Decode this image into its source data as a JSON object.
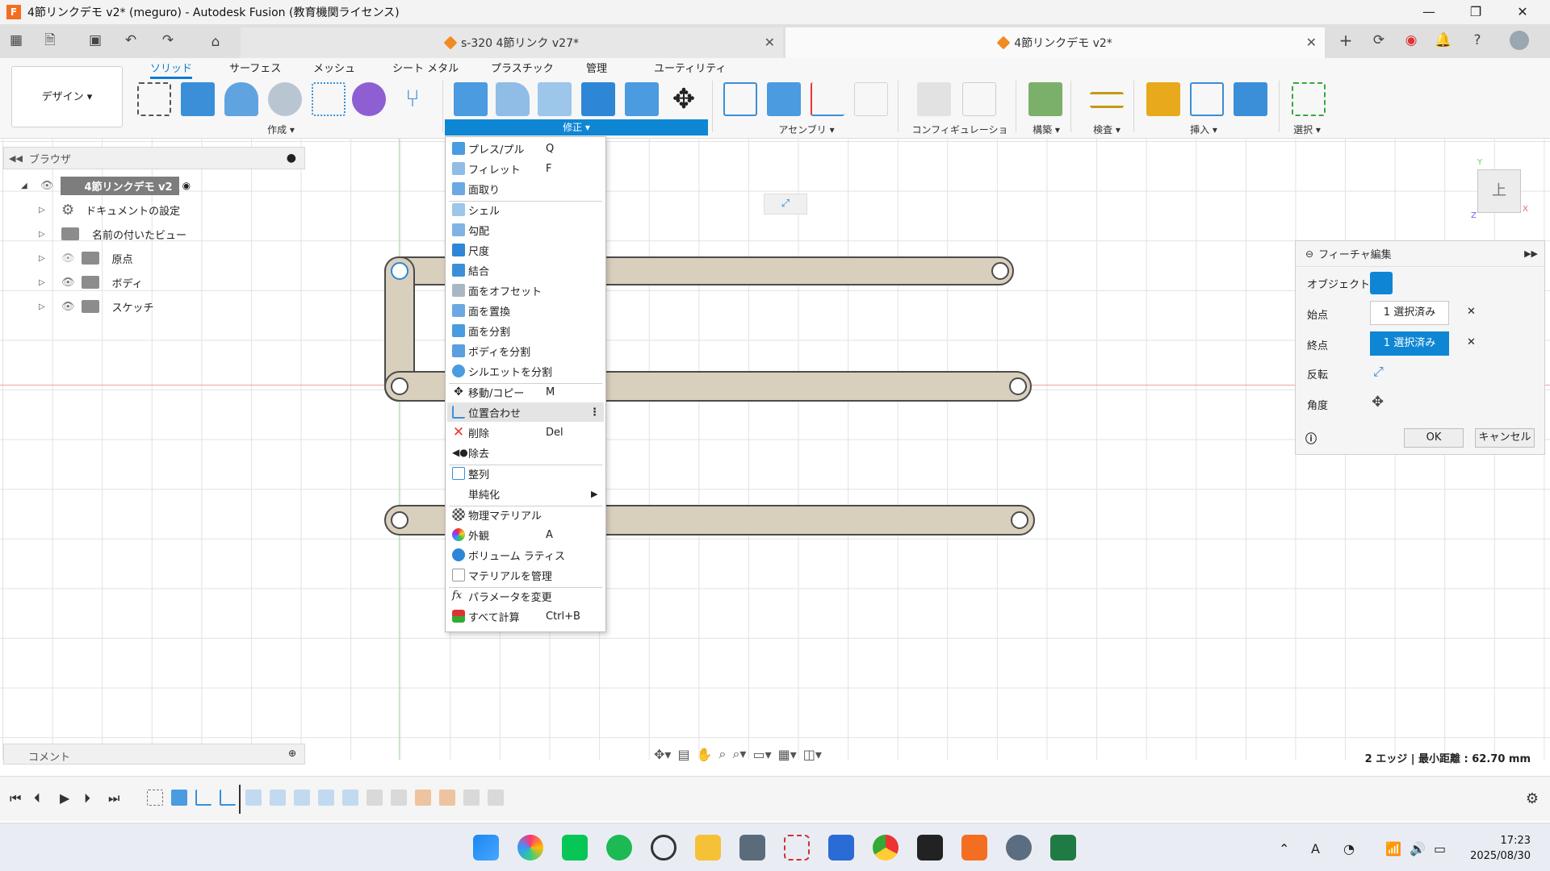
{
  "window": {
    "title": "4節リンクデモ v2* (meguro) - Autodesk Fusion (教育機関ライセンス)",
    "app_icon": "F"
  },
  "tabs": {
    "inactive": "s-320 4節リンク v27*",
    "active": "4節リンクデモ v2*"
  },
  "ribbon": {
    "workspace": "デザイン ▾",
    "tabs": [
      "ソリッド",
      "サーフェス",
      "メッシュ",
      "シート メタル",
      "プラスチック",
      "管理",
      "ユーティリティ"
    ],
    "groups": {
      "create": "作成 ▾",
      "modify": "修正 ▾",
      "assemble": "アセンブリ ▾",
      "config": "コンフィギュレーション ▾",
      "construct": "構築 ▾",
      "inspect": "検査 ▾",
      "insert": "挿入 ▾",
      "select": "選択 ▾"
    }
  },
  "browser": {
    "title": "ブラウザ",
    "root": "4節リンクデモ v2",
    "items": [
      "ドキュメントの設定",
      "名前の付いたビュー",
      "原点",
      "ボディ",
      "スケッチ"
    ]
  },
  "comment": "コメント",
  "menu": {
    "items": [
      {
        "label": "プレス/プル",
        "shortcut": "Q"
      },
      {
        "label": "フィレット",
        "shortcut": "F"
      },
      {
        "label": "面取り",
        "shortcut": ""
      },
      {
        "label": "シェル",
        "shortcut": ""
      },
      {
        "label": "勾配",
        "shortcut": ""
      },
      {
        "label": "尺度",
        "shortcut": ""
      },
      {
        "label": "結合",
        "shortcut": ""
      },
      {
        "label": "面をオフセット",
        "shortcut": ""
      },
      {
        "label": "面を置換",
        "shortcut": ""
      },
      {
        "label": "面を分割",
        "shortcut": ""
      },
      {
        "label": "ボディを分割",
        "shortcut": ""
      },
      {
        "label": "シルエットを分割",
        "shortcut": ""
      },
      {
        "label": "移動/コピー",
        "shortcut": "M"
      },
      {
        "label": "位置合わせ",
        "shortcut": "⋮"
      },
      {
        "label": "削除",
        "shortcut": "Del"
      },
      {
        "label": "除去",
        "shortcut": ""
      },
      {
        "label": "整列",
        "shortcut": ""
      },
      {
        "label": "単純化",
        "shortcut": "▶"
      },
      {
        "label": "物理マテリアル",
        "shortcut": ""
      },
      {
        "label": "外観",
        "shortcut": "A"
      },
      {
        "label": "ボリューム ラティス",
        "shortcut": ""
      },
      {
        "label": "マテリアルを管理",
        "shortcut": ""
      },
      {
        "label": "パラメータを変更",
        "shortcut": ""
      },
      {
        "label": "すべて計算",
        "shortcut": "Ctrl+B"
      }
    ]
  },
  "dialog": {
    "title": "フィーチャ編集",
    "object_label": "オブジェクト",
    "start_label": "始点",
    "start_value": "1 選択済み",
    "end_label": "終点",
    "end_value": "1 選択済み",
    "flip_label": "反転",
    "angle_label": "角度",
    "ok": "OK",
    "cancel": "キャンセル"
  },
  "viewcube": {
    "face": "上",
    "y": "Y",
    "x": "X",
    "z": "Z"
  },
  "status": "2 エッジ | 最小距離 : 62.70 mm",
  "clock": {
    "time": "17:23",
    "date": "2025/08/30"
  },
  "tray": {
    "ime": "A"
  }
}
